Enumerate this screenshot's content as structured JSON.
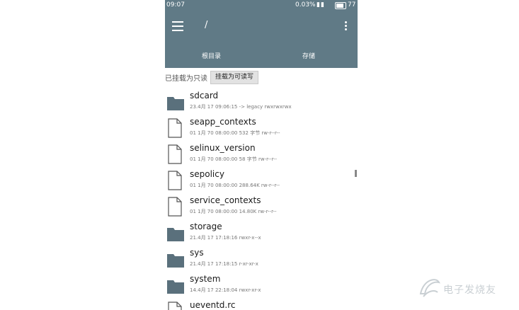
{
  "status_bar": {
    "time": "09:07",
    "speed": "0.03%",
    "battery_level": "77"
  },
  "app_bar": {
    "path": "/",
    "tabs": [
      {
        "label": "根目录"
      },
      {
        "label": "存储"
      }
    ]
  },
  "mount": {
    "readonly_label": "已挂载为只读",
    "readwrite_label": "挂载为可读写"
  },
  "files": [
    {
      "name": "sdcard",
      "meta": "23.4月 17 09:06:15 -> legacy  rwxrwxrwx",
      "type": "folder"
    },
    {
      "name": "seapp_contexts",
      "meta": "01 1月 70 08:00:00  532 字节  rw-r--r--",
      "type": "file"
    },
    {
      "name": "selinux_version",
      "meta": "01 1月 70 08:00:00  58 字节  rw-r--r--",
      "type": "file"
    },
    {
      "name": "sepolicy",
      "meta": "01 1月 70 08:00:00  288.64K  rw-r--r--",
      "type": "file"
    },
    {
      "name": "service_contexts",
      "meta": "01 1月 70 08:00:00  14.80K  rw-r--r--",
      "type": "file"
    },
    {
      "name": "storage",
      "meta": "21.4月 17 17:18:16  rwxr-x--x",
      "type": "folder"
    },
    {
      "name": "sys",
      "meta": "21.4月 17 17:18:15  r-xr-xr-x",
      "type": "folder"
    },
    {
      "name": "system",
      "meta": "14.4月 17 22:18:04  rwxr-xr-x",
      "type": "folder"
    },
    {
      "name": "ueventd.rc",
      "meta": "",
      "type": "file"
    }
  ],
  "watermark": {
    "text": "电子发烧友"
  },
  "colors": {
    "app_bar": "#607a86",
    "folder": "#5a707c"
  }
}
